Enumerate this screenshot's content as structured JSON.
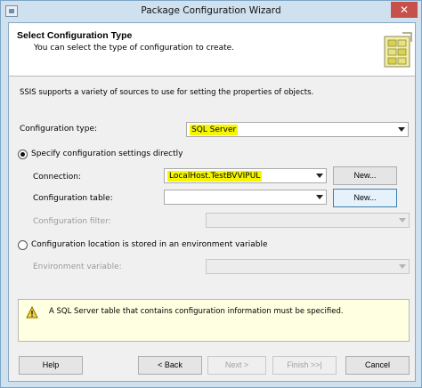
{
  "window": {
    "title": "Package Configuration Wizard",
    "close_glyph": "✕"
  },
  "header": {
    "title": "Select Configuration Type",
    "subtitle": "You can select the type of configuration to create."
  },
  "intro": "SSIS supports a variety of sources to use for setting the properties of objects.",
  "config_type": {
    "label": "Configuration type:",
    "value": "SQL Server"
  },
  "option_direct": {
    "label": "Specify configuration settings directly",
    "selected": true
  },
  "connection": {
    "label": "Connection:",
    "value": "LocalHost.TestBVVIPUL",
    "new_button": "New..."
  },
  "config_table": {
    "label": "Configuration table:",
    "value": "",
    "new_button": "New..."
  },
  "config_filter": {
    "label": "Configuration filter:",
    "value": ""
  },
  "option_env": {
    "label": "Configuration location is stored in an environment variable",
    "selected": false
  },
  "env_variable": {
    "label": "Environment variable:",
    "value": ""
  },
  "warning": {
    "text": "A SQL Server table that contains configuration information must be specified."
  },
  "buttons": {
    "help": "Help",
    "back": "< Back",
    "next": "Next >",
    "finish": "Finish >>|",
    "cancel": "Cancel"
  },
  "colors": {
    "highlight": "#f6f600",
    "header_bg": "#ffffff",
    "window_bg": "#cfe0ee"
  }
}
